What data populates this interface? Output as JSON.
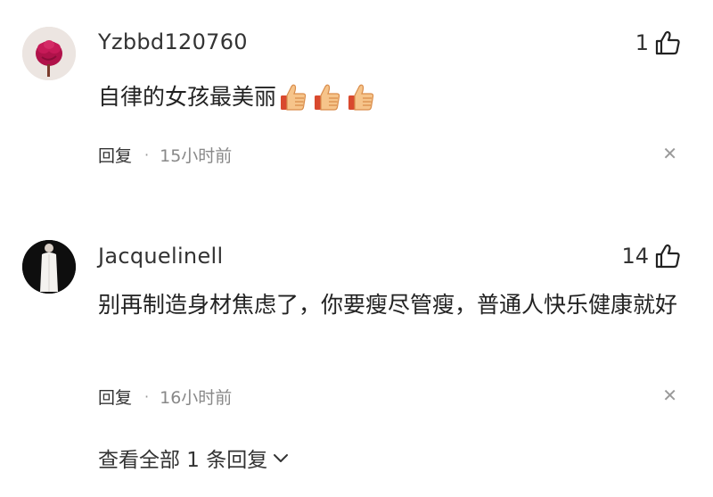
{
  "comments": [
    {
      "username": "Yzbbd120760",
      "likes": "1",
      "text": "自律的女孩最美丽",
      "emoji_count": 3,
      "emoji": "thumbs-up-emoji",
      "reply_label": "回复",
      "time": "15小时前"
    },
    {
      "username": "Jacquelinell",
      "likes": "14",
      "text": "别再制造身材焦虑了，你要瘦尽管瘦，普通人快乐健康就好",
      "reply_label": "回复",
      "time": "16小时前",
      "view_replies": "查看全部 1 条回复"
    }
  ],
  "icons": {
    "like": "thumbs-up-outline-icon",
    "close": "close-icon",
    "expand": "chevron-down-icon"
  }
}
